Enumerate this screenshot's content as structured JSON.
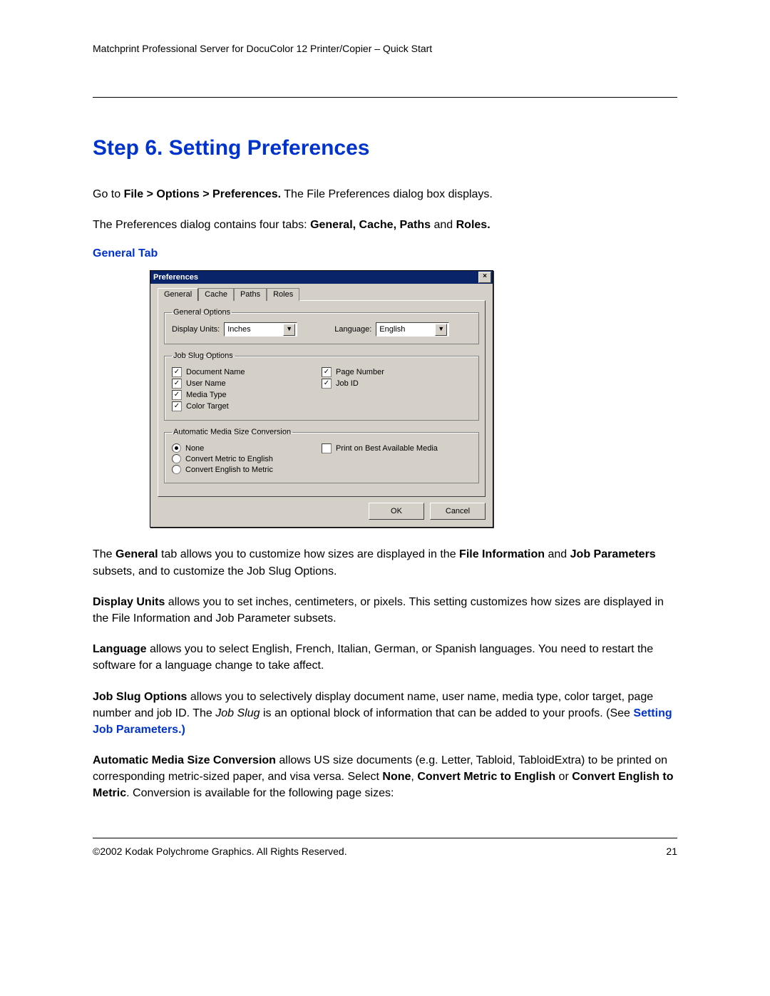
{
  "header": "Matchprint Professional Server for DocuColor 12 Printer/Copier – Quick Start",
  "title": "Step 6. Setting Preferences",
  "intro1_pre": "Go to ",
  "intro1_bold": "File > Options > Preferences.",
  "intro1_post": "  The File Preferences dialog box displays.",
  "intro2_pre": "The Preferences dialog contains four tabs: ",
  "intro2_bold": "General, Cache, Paths",
  "intro2_mid": " and ",
  "intro2_bold2": "Roles.",
  "subhead": "General Tab",
  "dialog": {
    "title": "Preferences",
    "tabs": [
      "General",
      "Cache",
      "Paths",
      "Roles"
    ],
    "group1": {
      "legend": "General Options",
      "display_units_label": "Display Units:",
      "display_units_value": "Inches",
      "language_label": "Language:",
      "language_value": "English"
    },
    "group2": {
      "legend": "Job Slug Options",
      "left": [
        "Document Name",
        "User Name",
        "Media Type",
        "Color Target"
      ],
      "right": [
        "Page Number",
        "Job ID"
      ]
    },
    "group3": {
      "legend": "Automatic Media Size Conversion",
      "radios": [
        "None",
        "Convert Metric to English",
        "Convert English to Metric"
      ],
      "checkbox": "Print on Best Available Media"
    },
    "ok": "OK",
    "cancel": "Cancel"
  },
  "para1": {
    "a": "The ",
    "b": "General",
    "c": " tab allows you to customize how sizes are displayed in the ",
    "d": "File Information",
    "e": " and ",
    "f": "Job Parameters",
    "g": " subsets, and to customize the Job Slug Options."
  },
  "para2": {
    "a": "Display Units",
    "b": " allows you to set inches, centimeters, or pixels. This setting customizes how sizes are displayed in the File Information and Job Parameter subsets."
  },
  "para3": {
    "a": "Language",
    "b": " allows you to select English, French, Italian, German, or Spanish languages. You need to restart the software for a language change to take affect."
  },
  "para4": {
    "a": "Job Slug Options",
    "b": " allows you to selectively display document name, user name, media type, color target, page number and job ID. The ",
    "c": "Job Slug",
    "d": " is an optional block of information that can be added to your proofs. (See ",
    "link": "Setting Job Parameters.)"
  },
  "para5": {
    "a": "Automatic Media Size Conversion",
    "b": " allows US size documents (e.g. Letter, Tabloid, TabloidExtra) to be printed on corresponding metric-sized paper, and visa versa. Select ",
    "c": "None",
    "d": ", ",
    "e": "Convert Metric to English",
    "f": " or ",
    "g": "Convert English to Metric",
    "h": ". Conversion is available for the following page sizes:"
  },
  "footer_left": "©2002 Kodak Polychrome Graphics. All Rights Reserved.",
  "footer_right": "21"
}
